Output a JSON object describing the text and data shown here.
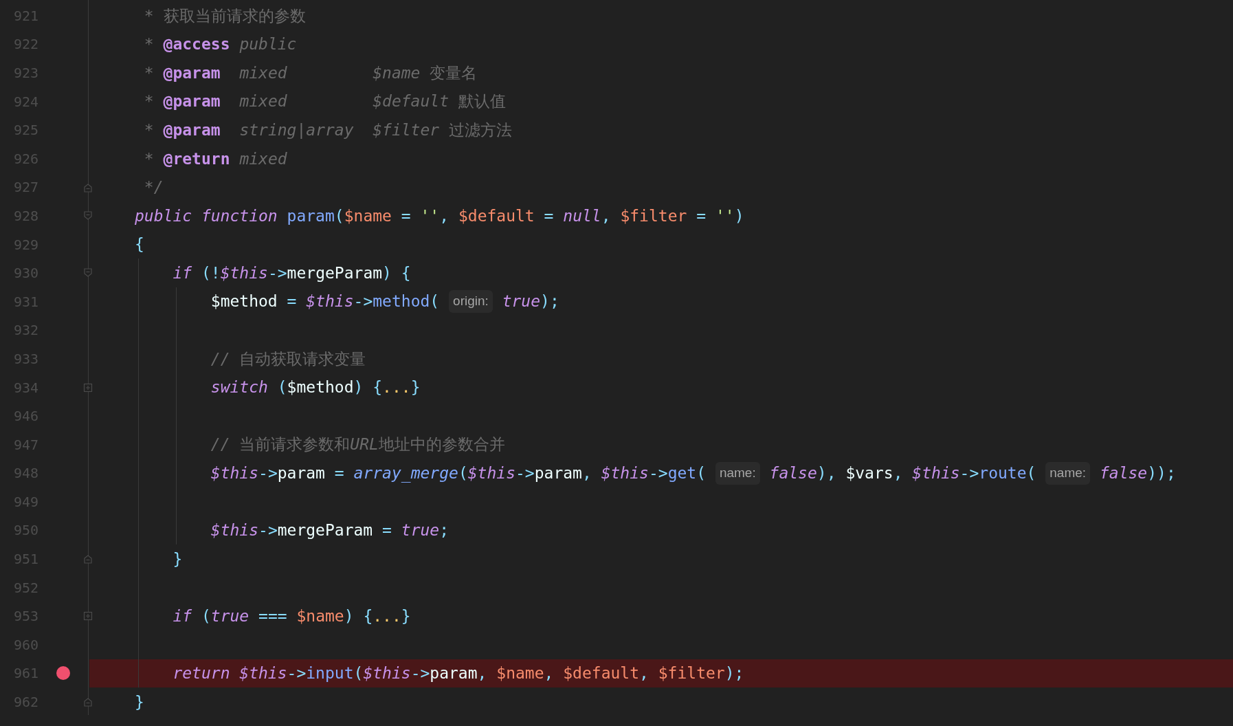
{
  "lines": [
    {
      "number": "921",
      "breakpoint": false,
      "tokens": [
        {
          "kind": "note",
          "text": " * 获取当前请求的参数"
        }
      ]
    },
    {
      "number": "922",
      "breakpoint": false,
      "tokens": [
        {
          "kind": "note",
          "text": " * "
        },
        {
          "kind": "tag",
          "text": "@access "
        },
        {
          "kind": "comment",
          "text": "public"
        }
      ]
    },
    {
      "number": "923",
      "breakpoint": false,
      "tokens": [
        {
          "kind": "note",
          "text": " * "
        },
        {
          "kind": "tag",
          "text": "@param  "
        },
        {
          "kind": "comment",
          "text": "mixed         $name"
        },
        {
          "kind": "note",
          "text": " 变量名"
        }
      ]
    },
    {
      "number": "924",
      "breakpoint": false,
      "tokens": [
        {
          "kind": "note",
          "text": " * "
        },
        {
          "kind": "tag",
          "text": "@param  "
        },
        {
          "kind": "comment",
          "text": "mixed         $default"
        },
        {
          "kind": "note",
          "text": " 默认值"
        }
      ]
    },
    {
      "number": "925",
      "breakpoint": false,
      "tokens": [
        {
          "kind": "note",
          "text": " * "
        },
        {
          "kind": "tag",
          "text": "@param  "
        },
        {
          "kind": "comment",
          "text": "string|array  $filter"
        },
        {
          "kind": "note",
          "text": " 过滤方法"
        }
      ]
    },
    {
      "number": "926",
      "breakpoint": false,
      "tokens": [
        {
          "kind": "note",
          "text": " * "
        },
        {
          "kind": "tag",
          "text": "@return "
        },
        {
          "kind": "comment",
          "text": "mixed"
        }
      ]
    },
    {
      "number": "927",
      "breakpoint": false,
      "marker": {
        "kind": "fold-end"
      },
      "tokens": [
        {
          "kind": "comment",
          "text": " */"
        }
      ]
    },
    {
      "number": "928",
      "breakpoint": false,
      "marker": {
        "kind": "fold-start"
      },
      "tokens": [
        {
          "kind": "keyword",
          "text": "public function "
        },
        {
          "kind": "function",
          "text": "param"
        },
        {
          "kind": "operator",
          "text": "("
        },
        {
          "kind": "variable",
          "text": "$name"
        },
        {
          "kind": "operator",
          "text": " = "
        },
        {
          "kind": "string",
          "text": "''"
        },
        {
          "kind": "operator",
          "text": ", "
        },
        {
          "kind": "variable",
          "text": "$default"
        },
        {
          "kind": "operator",
          "text": " = "
        },
        {
          "kind": "keyword",
          "text": "null"
        },
        {
          "kind": "operator",
          "text": ", "
        },
        {
          "kind": "variable",
          "text": "$filter"
        },
        {
          "kind": "operator",
          "text": " = "
        },
        {
          "kind": "string",
          "text": "''"
        },
        {
          "kind": "operator",
          "text": ")"
        }
      ]
    },
    {
      "number": "929",
      "breakpoint": false,
      "tokens": [
        {
          "kind": "operator",
          "text": "{"
        }
      ]
    },
    {
      "number": "930",
      "breakpoint": false,
      "marker": {
        "kind": "fold-start"
      },
      "tokens": [
        {
          "kind": "keyword",
          "text": "    if "
        },
        {
          "kind": "operator",
          "text": "(!"
        },
        {
          "kind": "keyword",
          "text": "$this"
        },
        {
          "kind": "operator",
          "text": "->"
        },
        {
          "kind": "identifier",
          "text": "mergeParam"
        },
        {
          "kind": "operator",
          "text": ") {"
        }
      ]
    },
    {
      "number": "931",
      "breakpoint": false,
      "tokens": [
        {
          "kind": "identifier",
          "text": "        $method"
        },
        {
          "kind": "operator",
          "text": " = "
        },
        {
          "kind": "keyword",
          "text": "$this"
        },
        {
          "kind": "operator",
          "text": "->"
        },
        {
          "kind": "function",
          "text": "method"
        },
        {
          "kind": "operator",
          "text": "( "
        },
        {
          "kind": "hint",
          "text": "origin: "
        },
        {
          "kind": "keyword",
          "text": "true"
        },
        {
          "kind": "operator",
          "text": ");"
        }
      ]
    },
    {
      "number": "932",
      "breakpoint": false
    },
    {
      "number": "933",
      "breakpoint": false,
      "tokens": [
        {
          "kind": "comment",
          "text": "        // "
        },
        {
          "kind": "note",
          "text": "自动获取请求变量"
        }
      ]
    },
    {
      "number": "934",
      "breakpoint": false,
      "marker": {
        "kind": "fold-collapsed"
      },
      "tokens": [
        {
          "kind": "keyword",
          "text": "        switch "
        },
        {
          "kind": "operator",
          "text": "("
        },
        {
          "kind": "identifier",
          "text": "$method"
        },
        {
          "kind": "operator",
          "text": ") {"
        },
        {
          "kind": "dots",
          "text": "..."
        },
        {
          "kind": "operator",
          "text": "}"
        }
      ]
    },
    {
      "number": "946",
      "breakpoint": false
    },
    {
      "number": "947",
      "breakpoint": false,
      "tokens": [
        {
          "kind": "comment",
          "text": "        // "
        },
        {
          "kind": "note",
          "text": "当前请求参数和"
        },
        {
          "kind": "comment",
          "text": "URL"
        },
        {
          "kind": "note",
          "text": "地址中的参数合并"
        }
      ]
    },
    {
      "number": "948",
      "breakpoint": false,
      "tokens": [
        {
          "kind": "keyword",
          "text": "        $this"
        },
        {
          "kind": "operator",
          "text": "->"
        },
        {
          "kind": "identifier",
          "text": "param"
        },
        {
          "kind": "operator",
          "text": " = "
        },
        {
          "kind": "function_italic",
          "text": "array_merge"
        },
        {
          "kind": "operator",
          "text": "("
        },
        {
          "kind": "keyword",
          "text": "$this"
        },
        {
          "kind": "operator",
          "text": "->"
        },
        {
          "kind": "identifier",
          "text": "param"
        },
        {
          "kind": "operator",
          "text": ", "
        },
        {
          "kind": "keyword",
          "text": "$this"
        },
        {
          "kind": "operator",
          "text": "->"
        },
        {
          "kind": "function",
          "text": "get"
        },
        {
          "kind": "operator",
          "text": "( "
        },
        {
          "kind": "hint",
          "text": "name: "
        },
        {
          "kind": "keyword",
          "text": "false"
        },
        {
          "kind": "operator",
          "text": "), "
        },
        {
          "kind": "identifier",
          "text": "$vars"
        },
        {
          "kind": "operator",
          "text": ", "
        },
        {
          "kind": "keyword",
          "text": "$this"
        },
        {
          "kind": "operator",
          "text": "->"
        },
        {
          "kind": "function",
          "text": "route"
        },
        {
          "kind": "operator",
          "text": "( "
        },
        {
          "kind": "hint",
          "text": "name: "
        },
        {
          "kind": "keyword",
          "text": "false"
        },
        {
          "kind": "operator",
          "text": "));"
        }
      ]
    },
    {
      "number": "949",
      "breakpoint": false
    },
    {
      "number": "950",
      "breakpoint": false,
      "tokens": [
        {
          "kind": "keyword",
          "text": "        $this"
        },
        {
          "kind": "operator",
          "text": "->"
        },
        {
          "kind": "identifier",
          "text": "mergeParam"
        },
        {
          "kind": "operator",
          "text": " = "
        },
        {
          "kind": "keyword",
          "text": "true"
        },
        {
          "kind": "operator",
          "text": ";"
        }
      ]
    },
    {
      "number": "951",
      "breakpoint": false,
      "marker": {
        "kind": "fold-end"
      },
      "tokens": [
        {
          "kind": "operator",
          "text": "    }"
        }
      ]
    },
    {
      "number": "952",
      "breakpoint": false
    },
    {
      "number": "953",
      "breakpoint": false,
      "marker": {
        "kind": "fold-collapsed"
      },
      "tokens": [
        {
          "kind": "keyword",
          "text": "    if "
        },
        {
          "kind": "operator",
          "text": "("
        },
        {
          "kind": "keyword",
          "text": "true"
        },
        {
          "kind": "operator",
          "text": " === "
        },
        {
          "kind": "variable",
          "text": "$name"
        },
        {
          "kind": "operator",
          "text": ") {"
        },
        {
          "kind": "dots",
          "text": "..."
        },
        {
          "kind": "operator",
          "text": "}"
        }
      ]
    },
    {
      "number": "960",
      "breakpoint": false
    },
    {
      "number": "961",
      "breakpoint": true,
      "tokens": [
        {
          "kind": "keyword",
          "text": "    return $this"
        },
        {
          "kind": "operator",
          "text": "->"
        },
        {
          "kind": "function",
          "text": "input"
        },
        {
          "kind": "operator",
          "text": "("
        },
        {
          "kind": "keyword",
          "text": "$this"
        },
        {
          "kind": "operator",
          "text": "->"
        },
        {
          "kind": "identifier",
          "text": "param"
        },
        {
          "kind": "operator",
          "text": ", "
        },
        {
          "kind": "variable",
          "text": "$name"
        },
        {
          "kind": "operator",
          "text": ", "
        },
        {
          "kind": "variable",
          "text": "$default"
        },
        {
          "kind": "operator",
          "text": ", "
        },
        {
          "kind": "variable",
          "text": "$filter"
        },
        {
          "kind": "operator",
          "text": ");"
        }
      ]
    },
    {
      "number": "962",
      "breakpoint": false,
      "marker": {
        "kind": "fold-end"
      },
      "tokens": [
        {
          "kind": "operator",
          "text": "}"
        }
      ]
    }
  ]
}
